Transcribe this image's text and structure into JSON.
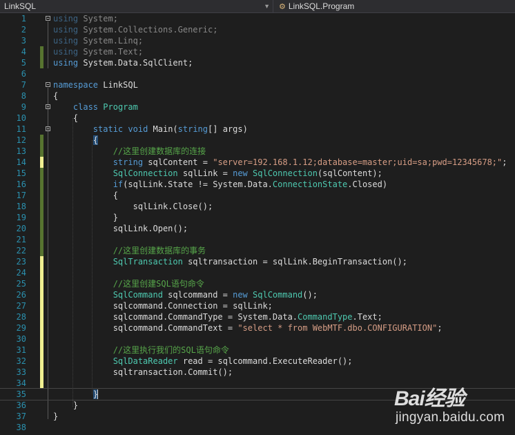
{
  "navbar": {
    "project_dropdown": "LinkSQL",
    "member_dropdown": "LinkSQL.Program",
    "member_icon": "class-icon"
  },
  "editor": {
    "lines": [
      {
        "n": "1"
      },
      {
        "n": "2"
      },
      {
        "n": "3"
      },
      {
        "n": "4"
      },
      {
        "n": "5"
      },
      {
        "n": "6"
      },
      {
        "n": "7"
      },
      {
        "n": "8"
      },
      {
        "n": "9"
      },
      {
        "n": "10"
      },
      {
        "n": "11"
      },
      {
        "n": "12"
      },
      {
        "n": "13"
      },
      {
        "n": "14"
      },
      {
        "n": "15"
      },
      {
        "n": "16"
      },
      {
        "n": "17"
      },
      {
        "n": "18"
      },
      {
        "n": "19"
      },
      {
        "n": "20"
      },
      {
        "n": "21"
      },
      {
        "n": "22"
      },
      {
        "n": "23"
      },
      {
        "n": "24"
      },
      {
        "n": "25"
      },
      {
        "n": "26"
      },
      {
        "n": "27"
      },
      {
        "n": "28"
      },
      {
        "n": "29"
      },
      {
        "n": "30"
      },
      {
        "n": "31"
      },
      {
        "n": "32"
      },
      {
        "n": "33"
      },
      {
        "n": "34"
      },
      {
        "n": "35"
      },
      {
        "n": "36"
      },
      {
        "n": "37"
      },
      {
        "n": "38"
      }
    ],
    "code": {
      "l1": [
        "using",
        " System;"
      ],
      "l2": [
        "using",
        " System.Collections.Generic;"
      ],
      "l3": [
        "using",
        " System.Linq;"
      ],
      "l4": [
        "using",
        " System.Text;"
      ],
      "l5": [
        "using",
        " System.Data.SqlClient;"
      ],
      "l7": [
        "namespace",
        " LinkSQL"
      ],
      "l8": "{",
      "l9": [
        "class",
        " ",
        "Program"
      ],
      "l10": "{",
      "l11": [
        "static",
        " ",
        "void",
        " Main(",
        "string",
        "[] args)"
      ],
      "l12": "{",
      "l13": "//这里创建数据库的连接",
      "l14": [
        "string",
        " sqlContent = ",
        "\"server=192.168.1.12;database=master;uid=sa;pwd=12345678;\"",
        ";"
      ],
      "l15": [
        "SqlConnection",
        " sqlLink = ",
        "new",
        " ",
        "SqlConnection",
        "(sqlContent);"
      ],
      "l16": [
        "if",
        "(sqlLink.State != System.Data.",
        "ConnectionState",
        ".Closed)"
      ],
      "l17": "{",
      "l18": "sqlLink.Close();",
      "l19": "}",
      "l20": "sqlLink.Open();",
      "l22": "//这里创建数据库的事务",
      "l23": [
        "SqlTransaction",
        " sqltransaction = sqlLink.BeginTransaction();"
      ],
      "l25": "//这里创建SQL语句命令",
      "l26": [
        "SqlCommand",
        " sqlcommand = ",
        "new",
        " ",
        "SqlCommand",
        "();"
      ],
      "l27": "sqlcommand.Connection = sqlLink;",
      "l28": [
        "sqlcommand.CommandType = System.Data.",
        "CommandType",
        ".Text;"
      ],
      "l29": [
        "sqlcommand.CommandText = ",
        "\"select * from WebMTF.dbo.CONFIGURATION\"",
        ";"
      ],
      "l31": "//这里执行我们的SQL语句命令",
      "l32": [
        "SqlDataReader",
        " read = sqlcommand.ExecuteReader();"
      ],
      "l33": "sqltransaction.Commit();",
      "l35": "}",
      "l36": "}",
      "l37": "}"
    }
  },
  "watermark": {
    "logo": "Bai经验",
    "site": "jingyan.baidu.com"
  },
  "colors": {
    "background": "#1e1e1e",
    "keyword": "#569cd6",
    "type": "#4ec9b0",
    "string": "#d69d85",
    "comment": "#57a64a",
    "line_number": "#2b91af",
    "change_saved": "#577430",
    "change_unsaved": "#efef91"
  }
}
